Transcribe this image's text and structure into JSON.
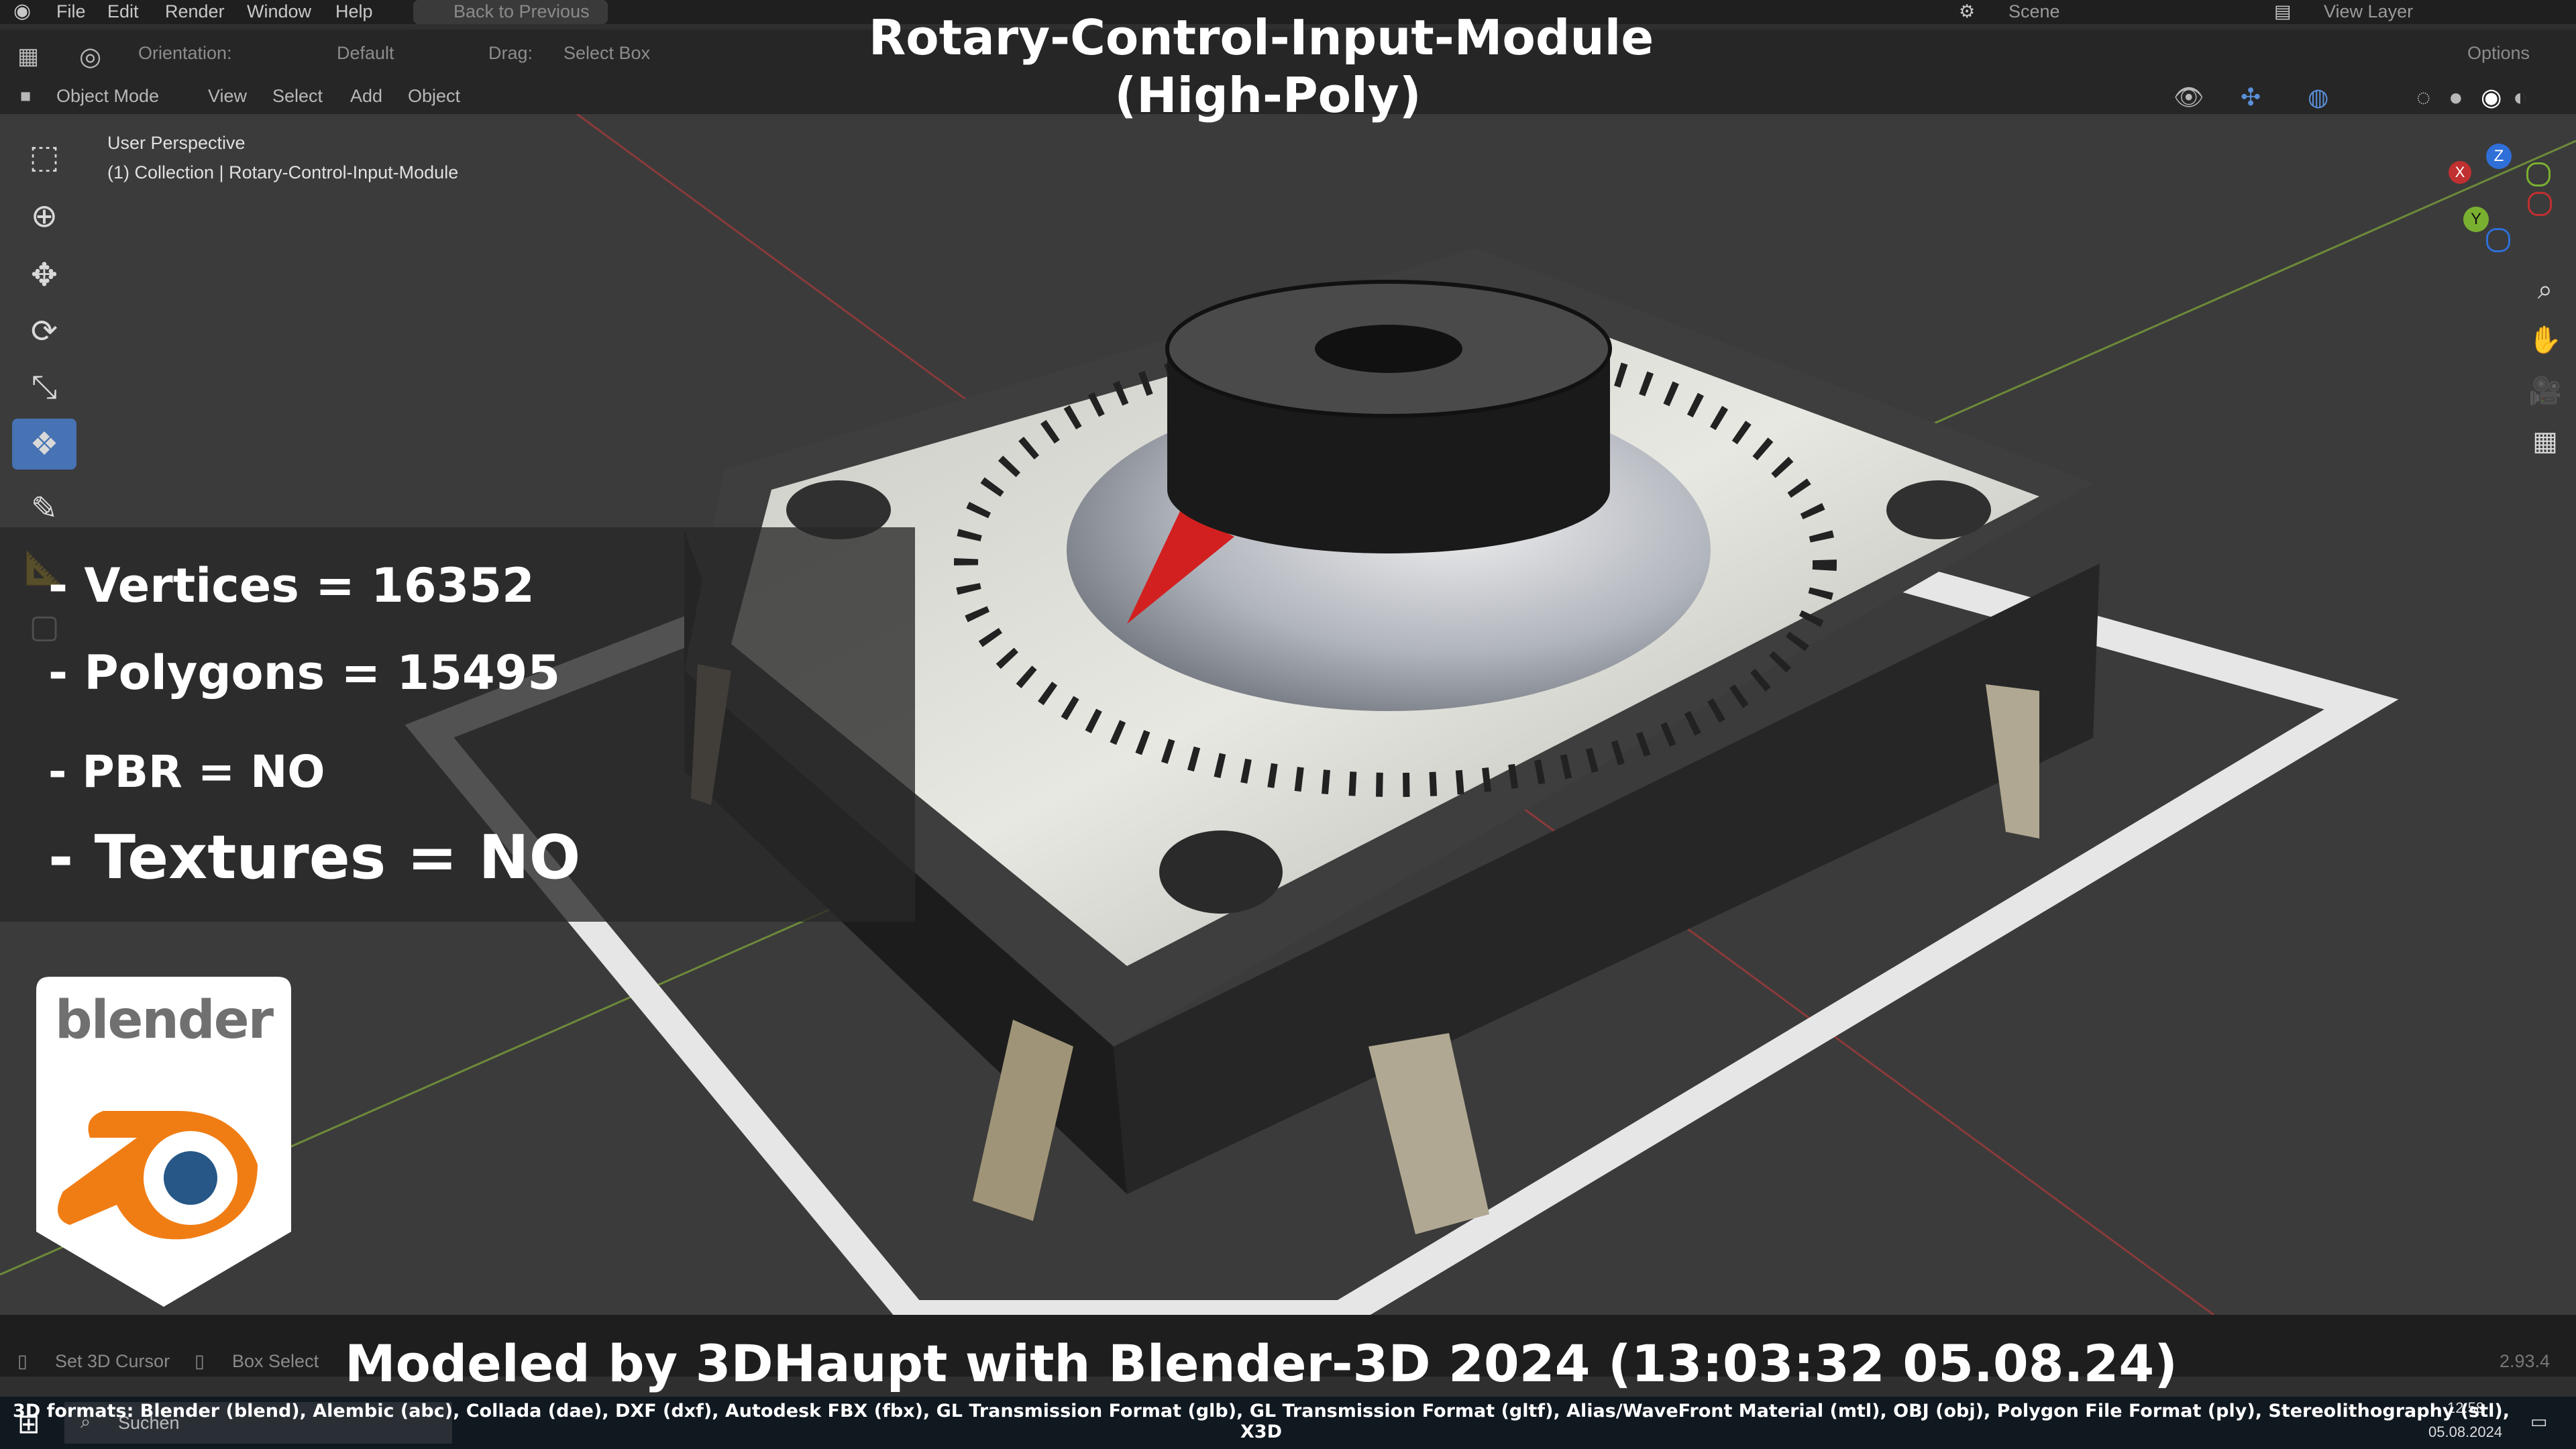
{
  "title": {
    "line1": "Rotary-Control-Input-Module",
    "line2": "(High-Poly)"
  },
  "menu": {
    "items": [
      "File",
      "Edit",
      "Render",
      "Window",
      "Help"
    ],
    "back_label": "Back to Previous",
    "scene": "Scene",
    "view_layer": "View Layer"
  },
  "header": {
    "orientation_label": "Orientation:",
    "orientation_value": "Default",
    "drag_label": "Drag:",
    "drag_value": "Select Box",
    "options": "Options",
    "mode": "Object Mode",
    "view": "View",
    "select": "Select",
    "add": "Add",
    "object": "Object"
  },
  "viewport": {
    "perspective": "User Perspective",
    "collection": "(1) Collection | Rotary-Control-Input-Module"
  },
  "stats": {
    "vertices": "- Vertices = 16352",
    "polygons": "- Polygons = 15495",
    "pbr": "- PBR =  NO",
    "textures": "- Textures = NO"
  },
  "logo": {
    "text": "blender"
  },
  "status": {
    "set_cursor": "Set 3D Cursor",
    "box_select": "Box Select",
    "version": "2.93.4"
  },
  "credit": "Modeled by 3DHaupt with Blender-3D 2024 (13:03:32  05.08.24)",
  "formats": "3D formats: Blender (blend), Alembic (abc), Collada (dae), DXF (dxf), Autodesk FBX (fbx), GL Transmission Format (glb), GL Transmission Format (gltf), Alias/WaveFront Material (mtl), OBJ (obj), Polygon File Format (ply), Stereolithography (stl), X3D",
  "taskbar": {
    "search": "Suchen",
    "time": "12:58",
    "date": "05.08.2024"
  },
  "gizmo": {
    "z": "Z",
    "y": "Y",
    "x": "X"
  },
  "colors": {
    "accent": "#4772b3",
    "red_marker": "#d22020",
    "logo_orange": "#f07d14",
    "logo_blue": "#265787"
  }
}
